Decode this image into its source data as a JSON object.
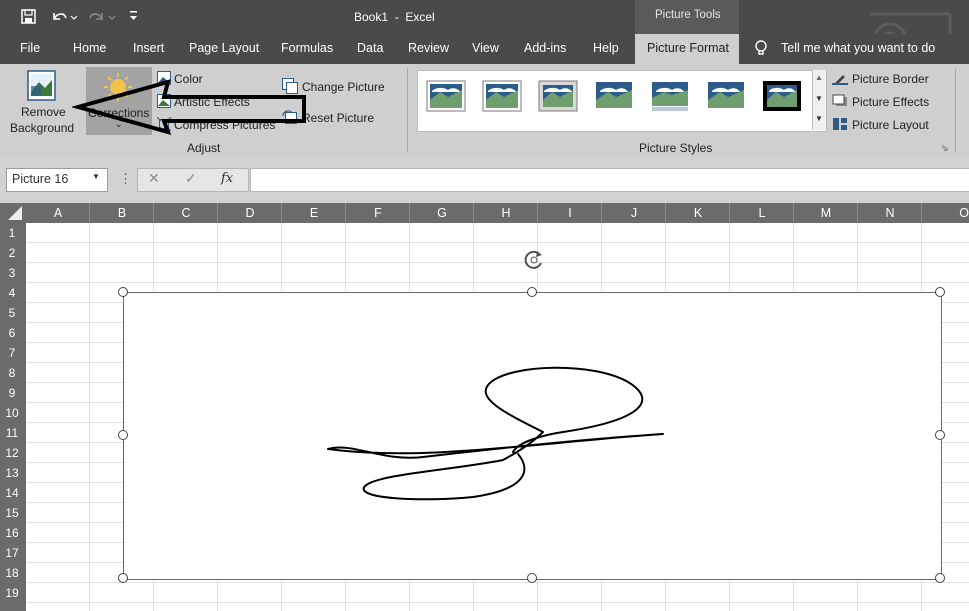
{
  "window": {
    "title": "Book1  -  Excel",
    "context_tab_group": "Picture Tools"
  },
  "quick_access": {
    "save_icon": "save-icon",
    "undo_icon": "undo-icon",
    "redo_icon": "redo-icon",
    "customize_icon": "customize-icon"
  },
  "tabs": [
    "File",
    "Home",
    "Insert",
    "Page Layout",
    "Formulas",
    "Data",
    "Review",
    "View",
    "Add-ins",
    "Help",
    "Picture Format"
  ],
  "active_tab": "Picture Format",
  "tell_me": "Tell me what you want to do",
  "ribbon": {
    "remove_background": [
      "Remove",
      "Background"
    ],
    "corrections": "Corrections",
    "color": "Color",
    "artistic_effects": "Artistic Effects",
    "compress_pictures": "Compress Pictures",
    "change_picture": "Change Picture",
    "reset_picture": "Reset Picture",
    "adjust_group": "Adjust",
    "picture_styles_group": "Picture Styles",
    "picture_border": "Picture Border",
    "picture_effects": "Picture Effects",
    "picture_layout": "Picture Layout"
  },
  "formula_bar": {
    "name_box": "Picture 16",
    "fx": "fx",
    "value": ""
  },
  "columns": [
    "A",
    "B",
    "C",
    "D",
    "E",
    "F",
    "G",
    "H",
    "I",
    "J",
    "K",
    "L",
    "M",
    "N",
    "O"
  ],
  "rows": [
    "1",
    "2",
    "3",
    "4",
    "5",
    "6",
    "7",
    "8",
    "9",
    "10",
    "11",
    "12",
    "13",
    "14",
    "15",
    "16",
    "17",
    "18",
    "19"
  ],
  "colors": {
    "titlebar": "#4a4a4a",
    "ribbon": "#cfcfcf",
    "header": "#6b6b6b",
    "accent": "#2e5c8a"
  }
}
